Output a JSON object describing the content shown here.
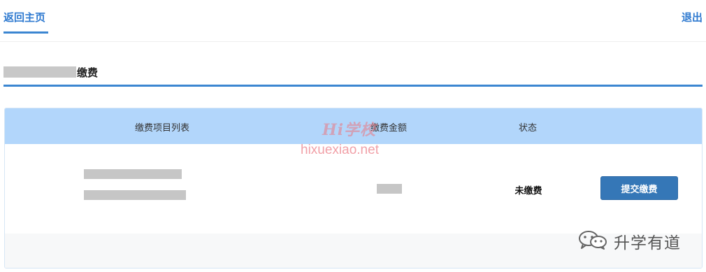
{
  "nav": {
    "back_label": "返回主页",
    "logout_label": "退出"
  },
  "section": {
    "title": "缴费"
  },
  "table": {
    "headers": [
      "缴费项目列表",
      "缴费金额",
      "状态"
    ],
    "rows": [
      {
        "item_name": "",
        "amount": "",
        "status": "未缴费",
        "action_label": "提交缴费"
      }
    ]
  },
  "watermarks": {
    "logo_text": "Hi学校",
    "url_text": "hixuexiao.net",
    "account_text": "升学有道",
    "account_icon": "wechat-icon"
  },
  "colors": {
    "accent": "#3b86d1",
    "header_bg": "#b2d6fb",
    "button_bg": "#3577b7",
    "link": "#2f7ad0"
  }
}
